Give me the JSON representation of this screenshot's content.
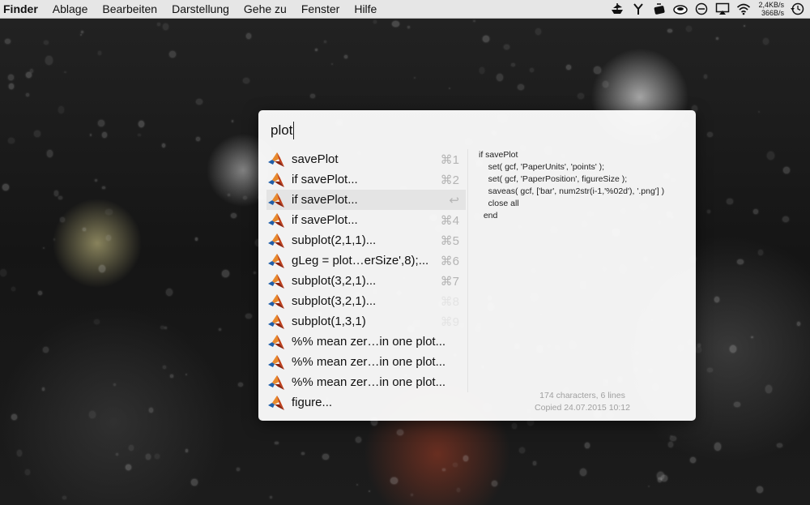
{
  "menubar": {
    "app": "Finder",
    "items": [
      "Ablage",
      "Bearbeiten",
      "Darstellung",
      "Gehe zu",
      "Fenster",
      "Hilfe"
    ],
    "status_icons": [
      "pirate-ship-icon",
      "branch-icon",
      "tea-icon",
      "cloud-icon",
      "no-entry-icon",
      "airplay-icon",
      "wifi-icon"
    ],
    "net_up": "2,4KB/s",
    "net_down": "366B/s",
    "time_machine_icon": "clock-arrow-icon"
  },
  "launcher": {
    "query": "plot",
    "selected_index": 2,
    "items": [
      {
        "label": "savePlot",
        "shortcut": "⌘1",
        "icon": "matlab-icon"
      },
      {
        "label": "if savePlot...",
        "shortcut": "⌘2",
        "icon": "matlab-icon"
      },
      {
        "label": "if savePlot...",
        "shortcut": "↩",
        "icon": "matlab-icon"
      },
      {
        "label": "if savePlot...",
        "shortcut": "⌘4",
        "icon": "matlab-icon"
      },
      {
        "label": "subplot(2,1,1)...",
        "shortcut": "⌘5",
        "icon": "matlab-icon"
      },
      {
        "label": "gLeg = plot…erSize',8);...",
        "shortcut": "⌘6",
        "icon": "matlab-icon"
      },
      {
        "label": "subplot(3,2,1)...",
        "shortcut": "⌘7",
        "icon": "matlab-icon"
      },
      {
        "label": "subplot(3,2,1)...",
        "shortcut": "⌘8",
        "icon": "matlab-icon"
      },
      {
        "label": "subplot(1,3,1)",
        "shortcut": "⌘9",
        "icon": "matlab-icon"
      },
      {
        "label": "%% mean zer…in one plot...",
        "shortcut": "",
        "icon": "matlab-icon"
      },
      {
        "label": "%% mean zer…in one plot...",
        "shortcut": "",
        "icon": "matlab-icon"
      },
      {
        "label": "%% mean zer…in one plot...",
        "shortcut": "",
        "icon": "matlab-icon"
      },
      {
        "label": "figure...",
        "shortcut": "",
        "icon": "matlab-icon"
      }
    ],
    "preview": "if savePlot\n    set( gcf, 'PaperUnits', 'points' );\n    set( gcf, 'PaperPosition', figureSize );\n    saveas( gcf, ['bar', num2str(i-1,'%02d'), '.png'] )\n    close all\n  end",
    "meta_chars": "174 characters, 6 lines",
    "meta_copied": "Copied 24.07.2015 10:12"
  }
}
